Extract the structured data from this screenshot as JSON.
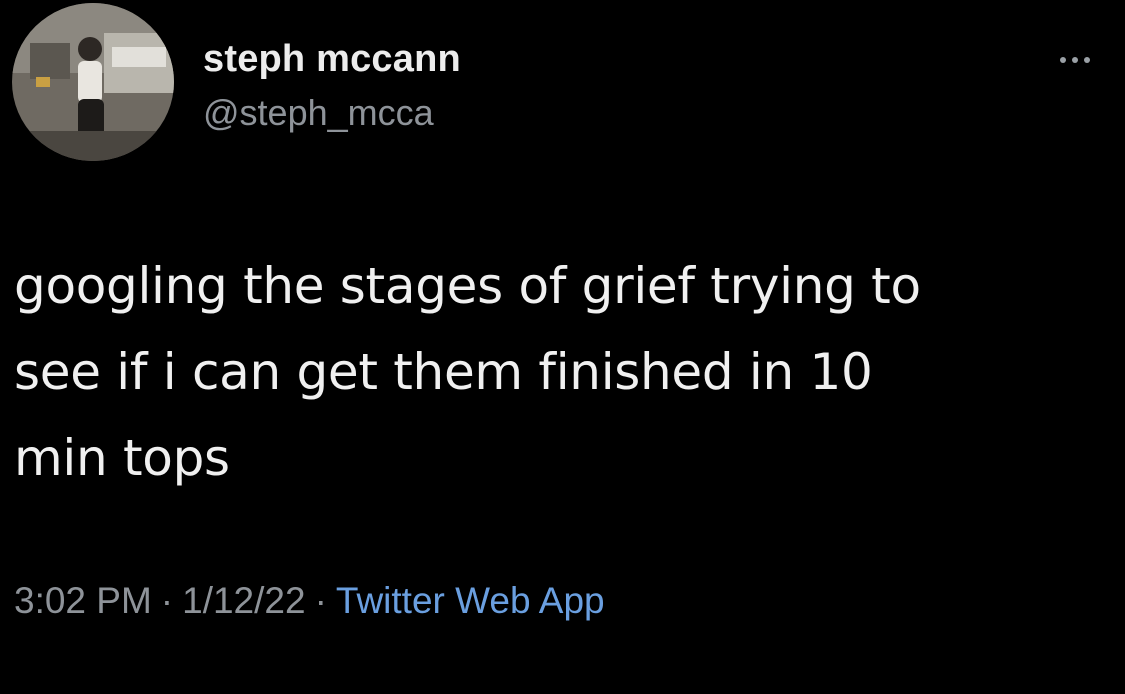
{
  "tweet": {
    "author": {
      "display_name": "steph mccann",
      "handle": "@steph_mcca",
      "avatar_icon": "profile-photo"
    },
    "more_icon": "more-options-icon",
    "text": "googling the stages of grief trying to\nsee if i can get them finished in 10\nmin tops",
    "time": "3:02 PM",
    "date": "1/12/22",
    "separator": "·",
    "source": "Twitter Web App"
  },
  "colors": {
    "background": "#000000",
    "text": "#f0f0f0",
    "secondary": "#8e9399",
    "link": "#6a9fe0"
  }
}
